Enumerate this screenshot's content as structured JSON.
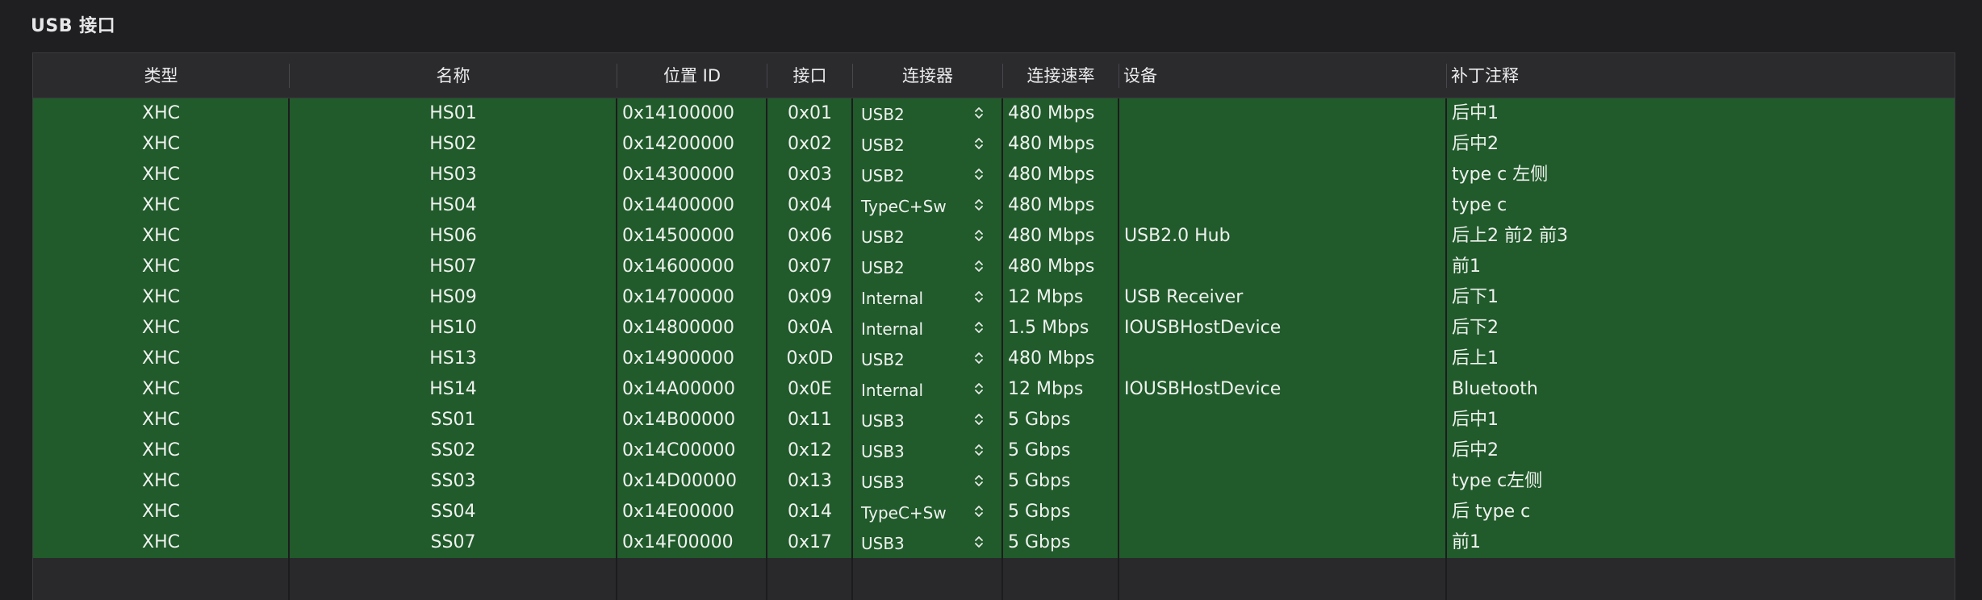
{
  "section_title": "USB 接口",
  "columns": {
    "type": "类型",
    "name": "名称",
    "location_id": "位置 ID",
    "port": "接口",
    "connector": "连接器",
    "speed": "连接速率",
    "device": "设备",
    "comment": "补丁注释"
  },
  "rows": [
    {
      "type": "XHC",
      "name": "HS01",
      "location_id": "0x14100000",
      "port": "0x01",
      "connector": "USB2",
      "speed": "480 Mbps",
      "device": "",
      "comment": "后中1"
    },
    {
      "type": "XHC",
      "name": "HS02",
      "location_id": "0x14200000",
      "port": "0x02",
      "connector": "USB2",
      "speed": "480 Mbps",
      "device": "",
      "comment": "后中2"
    },
    {
      "type": "XHC",
      "name": "HS03",
      "location_id": "0x14300000",
      "port": "0x03",
      "connector": "USB2",
      "speed": "480 Mbps",
      "device": "",
      "comment": "type c 左侧"
    },
    {
      "type": "XHC",
      "name": "HS04",
      "location_id": "0x14400000",
      "port": "0x04",
      "connector": "TypeC+Sw",
      "speed": "480 Mbps",
      "device": "",
      "comment": "type c"
    },
    {
      "type": "XHC",
      "name": "HS06",
      "location_id": "0x14500000",
      "port": "0x06",
      "connector": "USB2",
      "speed": "480 Mbps",
      "device": "USB2.0 Hub",
      "comment": "后上2 前2 前3"
    },
    {
      "type": "XHC",
      "name": "HS07",
      "location_id": "0x14600000",
      "port": "0x07",
      "connector": "USB2",
      "speed": "480 Mbps",
      "device": "",
      "comment": "前1"
    },
    {
      "type": "XHC",
      "name": "HS09",
      "location_id": "0x14700000",
      "port": "0x09",
      "connector": "Internal",
      "speed": "12 Mbps",
      "device": "USB Receiver",
      "comment": "后下1"
    },
    {
      "type": "XHC",
      "name": "HS10",
      "location_id": "0x14800000",
      "port": "0x0A",
      "connector": "Internal",
      "speed": "1.5 Mbps",
      "device": "IOUSBHostDevice",
      "comment": "后下2"
    },
    {
      "type": "XHC",
      "name": "HS13",
      "location_id": "0x14900000",
      "port": "0x0D",
      "connector": "USB2",
      "speed": "480 Mbps",
      "device": "",
      "comment": "后上1"
    },
    {
      "type": "XHC",
      "name": "HS14",
      "location_id": "0x14A00000",
      "port": "0x0E",
      "connector": "Internal",
      "speed": "12 Mbps",
      "device": "IOUSBHostDevice",
      "comment": "Bluetooth"
    },
    {
      "type": "XHC",
      "name": "SS01",
      "location_id": "0x14B00000",
      "port": "0x11",
      "connector": "USB3",
      "speed": "5 Gbps",
      "device": "",
      "comment": "后中1"
    },
    {
      "type": "XHC",
      "name": "SS02",
      "location_id": "0x14C00000",
      "port": "0x12",
      "connector": "USB3",
      "speed": "5 Gbps",
      "device": "",
      "comment": "后中2"
    },
    {
      "type": "XHC",
      "name": "SS03",
      "location_id": "0x14D00000",
      "port": "0x13",
      "connector": "USB3",
      "speed": "5 Gbps",
      "device": "",
      "comment": "type c左侧"
    },
    {
      "type": "XHC",
      "name": "SS04",
      "location_id": "0x14E00000",
      "port": "0x14",
      "connector": "TypeC+Sw",
      "speed": "5 Gbps",
      "device": "",
      "comment": "后 type c"
    },
    {
      "type": "XHC",
      "name": "SS07",
      "location_id": "0x14F00000",
      "port": "0x17",
      "connector": "USB3",
      "speed": "5 Gbps",
      "device": "",
      "comment": "前1"
    }
  ],
  "colors": {
    "row_selected": "#215a2b",
    "background": "#1f1f21",
    "panel": "#2b2b2e"
  }
}
